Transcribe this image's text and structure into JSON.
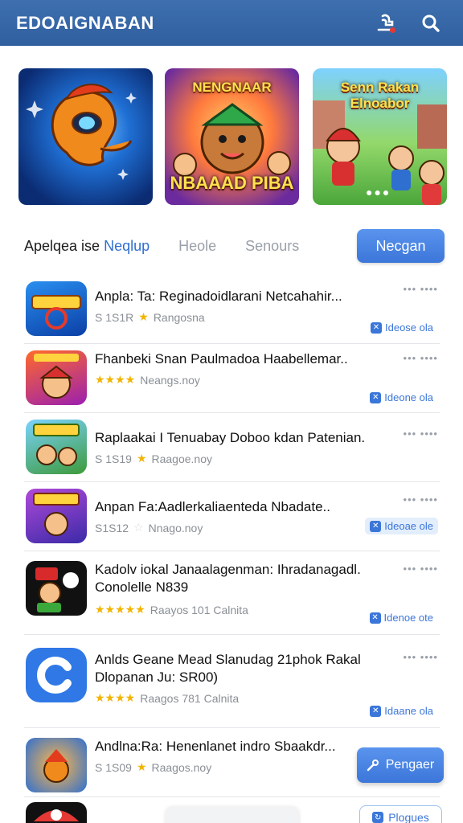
{
  "header": {
    "brand": "EDOAIGNABAN"
  },
  "hero": [
    {
      "title": "",
      "subtitle": ""
    },
    {
      "title": "NENGNAAR",
      "subtitle": "NBAAAD PIBA"
    },
    {
      "title": "Senn Rakan Elnoabor",
      "subtitle": ""
    }
  ],
  "tabs": {
    "active_prefix": "Apelqea ise ",
    "active_accent": "Neqlup",
    "items": [
      "Heole",
      "Senours"
    ],
    "button": "Necgan"
  },
  "list": [
    {
      "title": "Anpla: Ta: Reginadoidlarani Netcahahir...",
      "meta": "S 1S1R",
      "rating_text": "Rangosna",
      "stars": "★",
      "action": "Ideose ola",
      "action_filled": false
    },
    {
      "title": "Fhanbeki Snan Paulmadoa Haabellemar..",
      "meta": "",
      "rating_text": "Neangs.noy",
      "stars": "★★★★",
      "action": "Ideone ola",
      "action_filled": false
    },
    {
      "title": "Raplaakai I Tenuabay Doboo kdan Patenian.",
      "meta": "S 1S19",
      "rating_text": "Raagoe.noy",
      "stars": "★",
      "action": "",
      "action_filled": false
    },
    {
      "title": "Anpan Fa:Aadlerkaliaenteda Nbadate..",
      "meta": "S1S12",
      "rating_text": "Nnago.noy",
      "stars": "☆",
      "action": "Ideoae ole",
      "action_filled": true
    },
    {
      "title": "Kadolv iokal Janaalagenman: Ihradanagadl. Conolelle N839",
      "meta": "",
      "rating_text": "Raayos 101 Calnita",
      "stars": "★★★★★",
      "action": "Idenoe ote",
      "action_filled": false
    },
    {
      "title": "Anlds Geane Mead Slanudag 21phok Rakal Dlopanan Ju: SR00)",
      "meta": "",
      "rating_text": "Raagos 781 Calnita",
      "stars": "★★★★",
      "action": "Idaane ola",
      "action_filled": false
    },
    {
      "title": "Andlna:Ra: Henenlanet indro Sbaakdr...",
      "meta": "S 1S09",
      "rating_text": "Raagos.noy",
      "stars": "★",
      "action": "",
      "action_filled": false
    }
  ],
  "fab": {
    "label": "Pengaer"
  },
  "bottom": {
    "pill_text": "",
    "button": "Plogues"
  },
  "colors": {
    "header": "#2f5f9f",
    "accent": "#3b76d9",
    "star": "#f2b400"
  }
}
